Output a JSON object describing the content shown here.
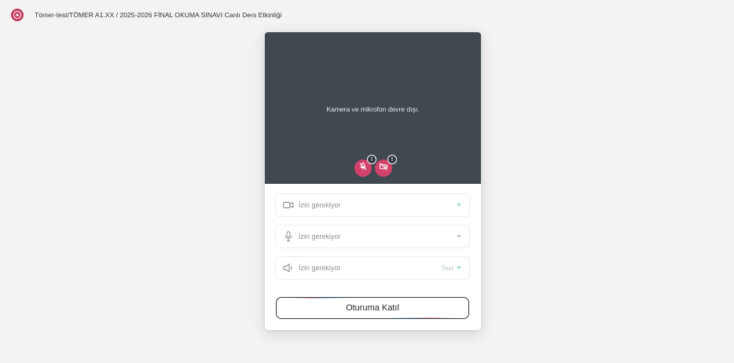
{
  "header": {
    "title": "Tömer-test/TÖMER A1.XX / 2025-2026 FİNAL OKUMA SINAVI Canlı Ders Etkinliği",
    "logo_icon": "university-seal-icon"
  },
  "preview": {
    "message": "Kamera ve mikrofon devre dışı.",
    "mic_button_icon": "mic-off-icon",
    "camera_button_icon": "camera-off-icon",
    "warning_badge": "!",
    "background_color": "#3f494f",
    "button_color": "#d2416b"
  },
  "devices": {
    "camera": {
      "icon": "camera-icon",
      "label": "İzin gerekiyor"
    },
    "microphone": {
      "icon": "microphone-icon",
      "label": "İzin gerekiyor"
    },
    "speaker": {
      "icon": "speaker-icon",
      "label": "İzin gerekiyor",
      "test_label": "Test"
    }
  },
  "join": {
    "label": "Oturuma Katıl"
  }
}
